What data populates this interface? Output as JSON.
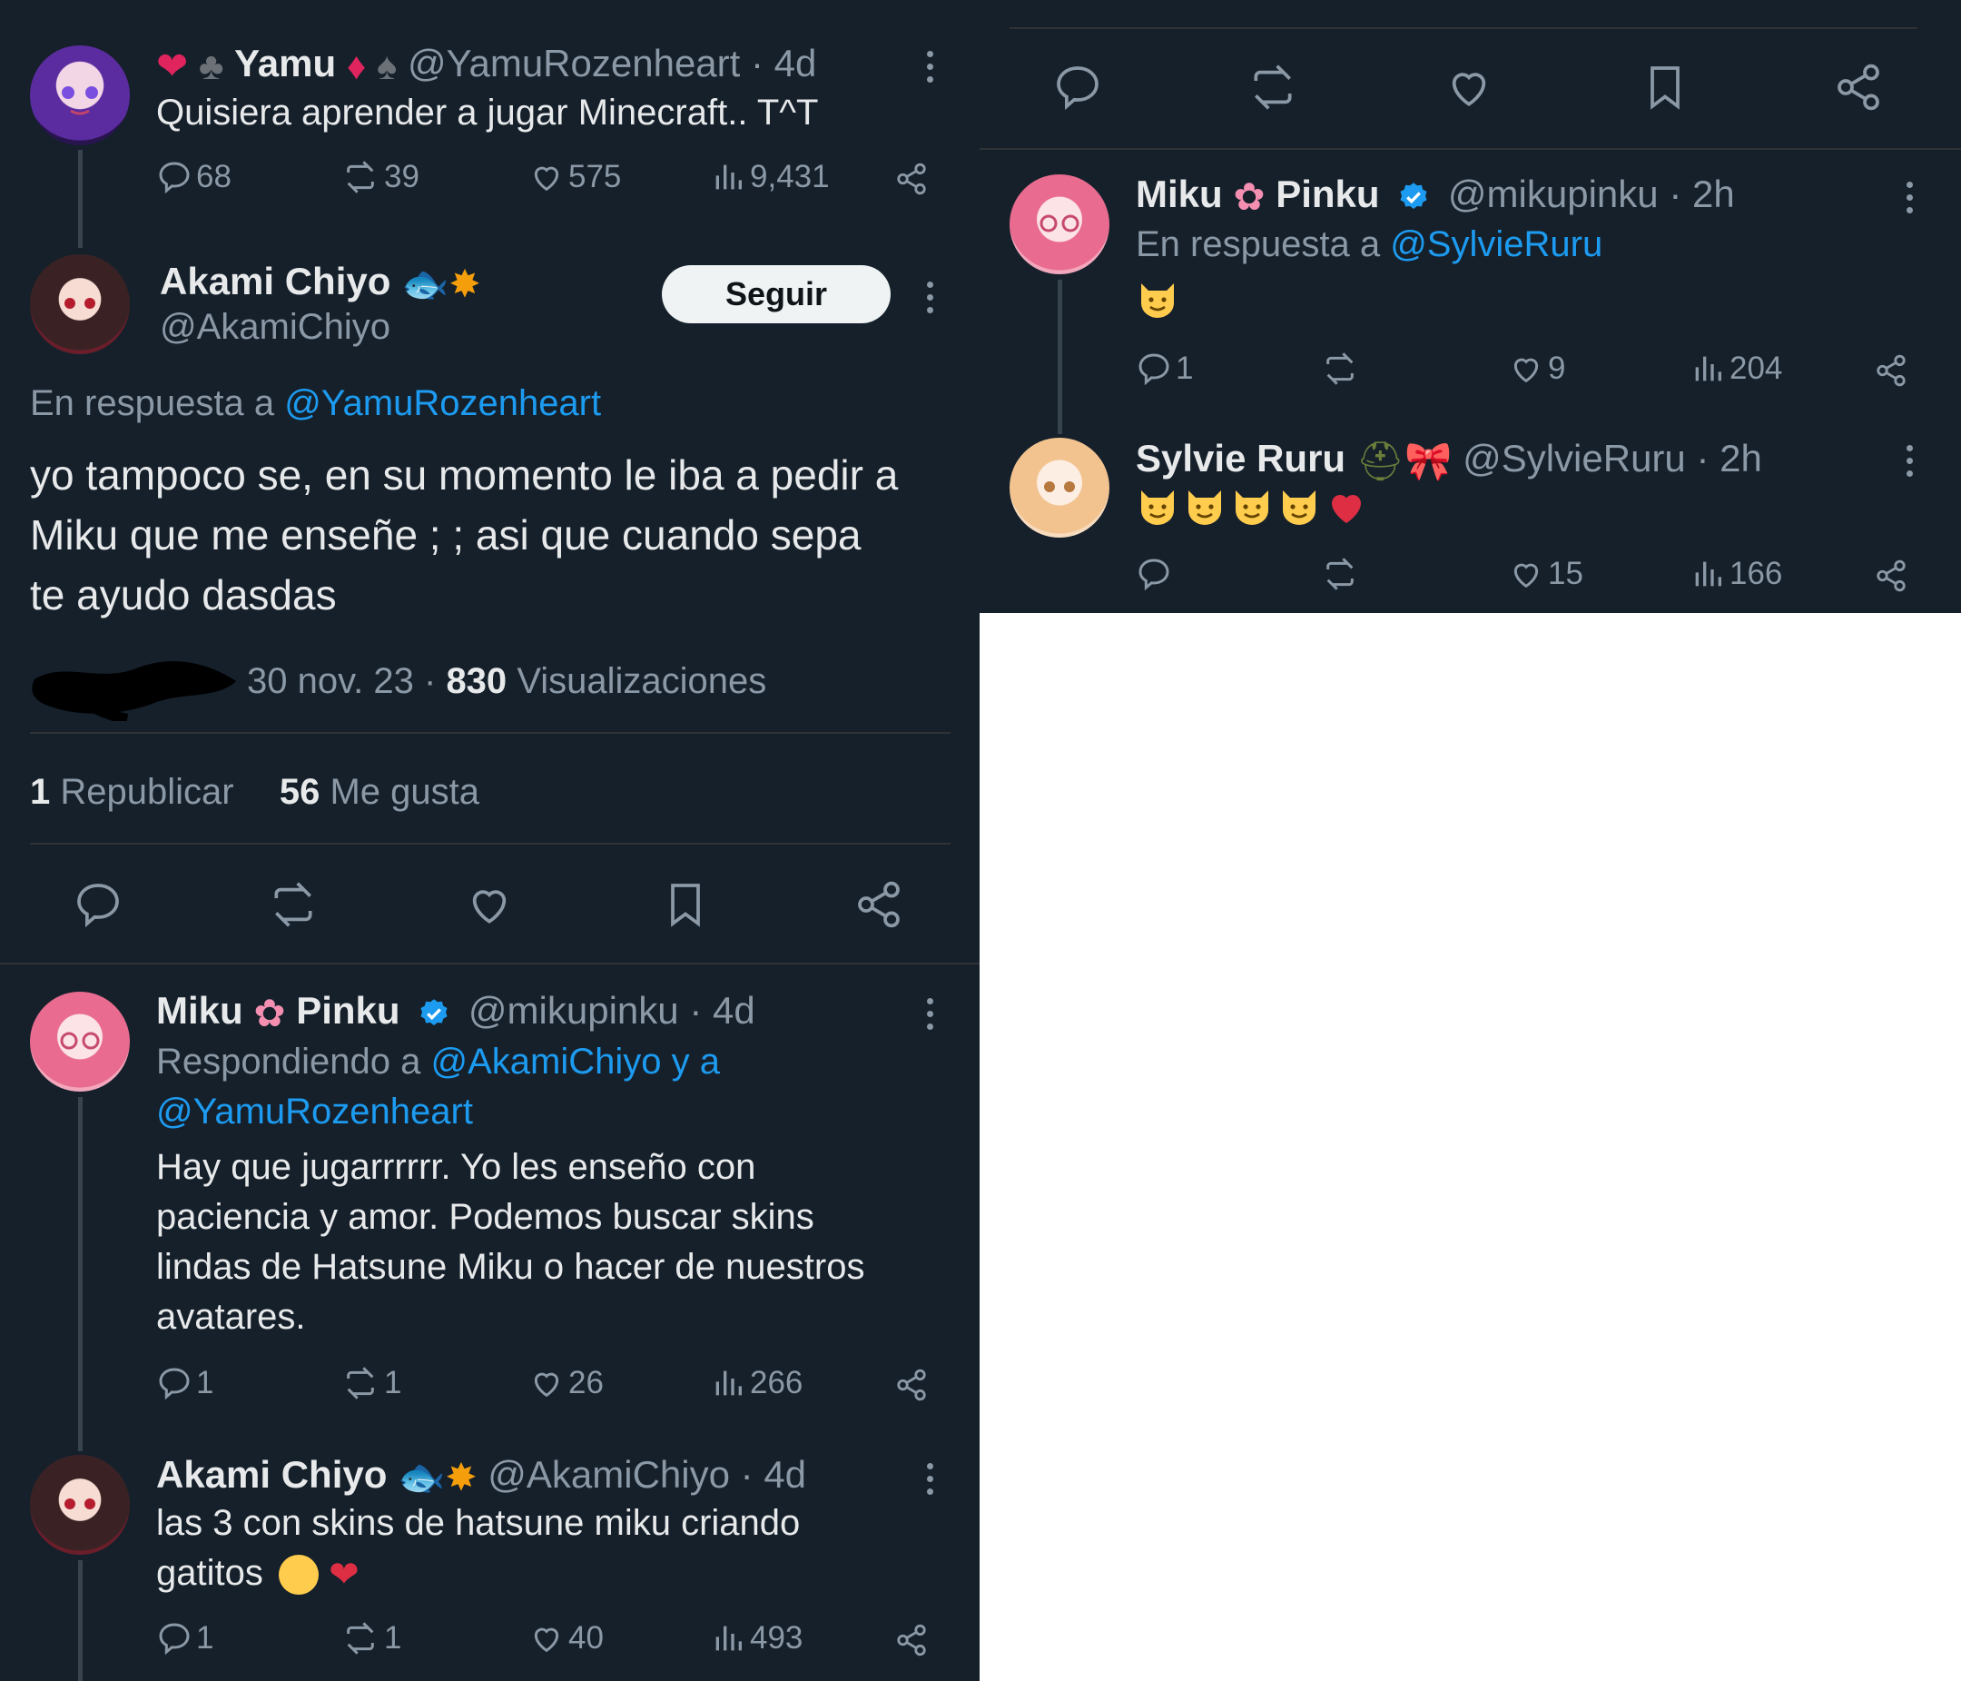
{
  "left": {
    "tweet_yamu": {
      "display_name": "Yamu",
      "handle": "@YamuRozenheart",
      "time": "4d",
      "text": "Quisiera aprender a jugar Minecraft.. T^T",
      "replies": "68",
      "reposts": "39",
      "likes": "575",
      "views": "9,431"
    },
    "main_tweet": {
      "display_name": "Akami Chiyo",
      "handle": "@AkamiChiyo",
      "follow_label": "Seguir",
      "reply_prefix": "En respuesta a",
      "reply_to": "@YamuRozenheart",
      "text": "yo tampoco se, en su momento le iba a pedir a Miku que me enseñe ; ; asi que cuando sepa te ayudo dasdas",
      "date": "30 nov. 23",
      "views_count": "830",
      "views_label": "Visualizaciones",
      "reposts_count": "1",
      "reposts_label": "Republicar",
      "likes_count": "56",
      "likes_label": "Me gusta"
    },
    "reply_miku": {
      "display_name_a": "Miku",
      "display_name_b": "Pinku",
      "handle": "@mikupinku",
      "time": "4d",
      "reply_prefix": "Respondiendo a",
      "reply_to_line1": "@AkamiChiyo y a",
      "reply_to_line2": "@YamuRozenheart",
      "text": "Hay que jugarrrrrr. Yo les enseño con paciencia y amor. Podemos buscar skins lindas de Hatsune Miku o hacer de nuestros avatares.",
      "replies": "1",
      "reposts": "1",
      "likes": "26",
      "views": "266"
    },
    "reply_akami": {
      "display_name": "Akami Chiyo",
      "handle": "@AkamiChiyo",
      "time": "4d",
      "text": "las 3 con skins de hatsune miku criando gatitos",
      "replies": "1",
      "reposts": "1",
      "likes": "40",
      "views": "493"
    }
  },
  "right": {
    "reply_miku": {
      "display_name_a": "Miku",
      "display_name_b": "Pinku",
      "handle": "@mikupinku",
      "time": "2h",
      "reply_prefix": "En respuesta a",
      "reply_to": "@SylvieRuru",
      "replies": "1",
      "likes": "9",
      "views": "204"
    },
    "reply_sylvie": {
      "display_name": "Sylvie Ruru",
      "handle": "@SylvieRuru",
      "time": "2h",
      "likes": "15",
      "views": "166"
    }
  },
  "colors": {
    "background": "#15202b",
    "text": "#e7e9ea",
    "muted": "#8b98a5",
    "link": "#1d9bf0",
    "divider": "#2f3336"
  },
  "icons": [
    "reply-icon",
    "repost-icon",
    "like-icon",
    "bookmark-icon",
    "share-icon",
    "views-icon",
    "more-icon",
    "verified-icon"
  ]
}
